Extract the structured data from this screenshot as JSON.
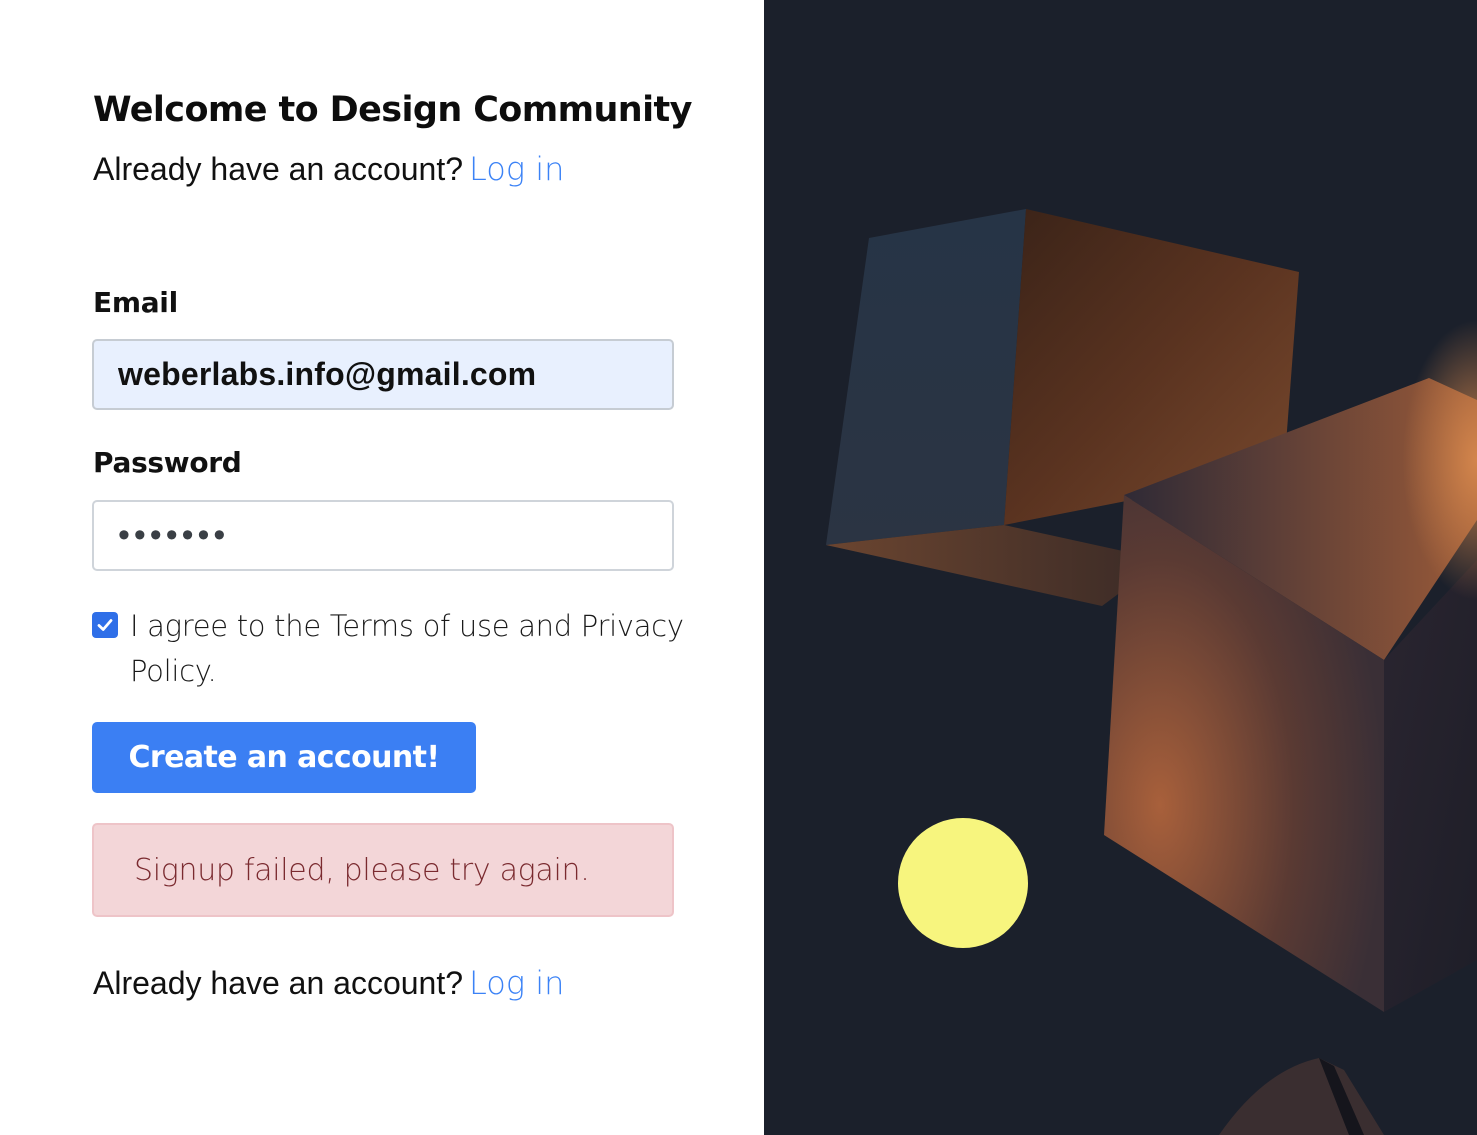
{
  "page": {
    "title": "Welcome to Design Community"
  },
  "login_prompt": {
    "text": "Already have an account?",
    "link_label": "Log in"
  },
  "form": {
    "email": {
      "label": "Email",
      "value": "weberlabs.info@gmail.com"
    },
    "password": {
      "label": "Password",
      "value": "•••••••"
    },
    "terms": {
      "checked": true,
      "text": "I agree to the Terms of use and Privacy Policy."
    },
    "submit_label": "Create an account!"
  },
  "error": {
    "message": "Signup failed, please try again."
  },
  "colors": {
    "accent": "#3b7ff3",
    "link": "#3b82f6",
    "error_bg": "#f3d6d8",
    "error_text": "#7a2a2f",
    "art_bg": "#1b202b",
    "sphere": "#f7f57e"
  },
  "art": {
    "description_icon": "abstract-3d-cubes-illustration"
  }
}
